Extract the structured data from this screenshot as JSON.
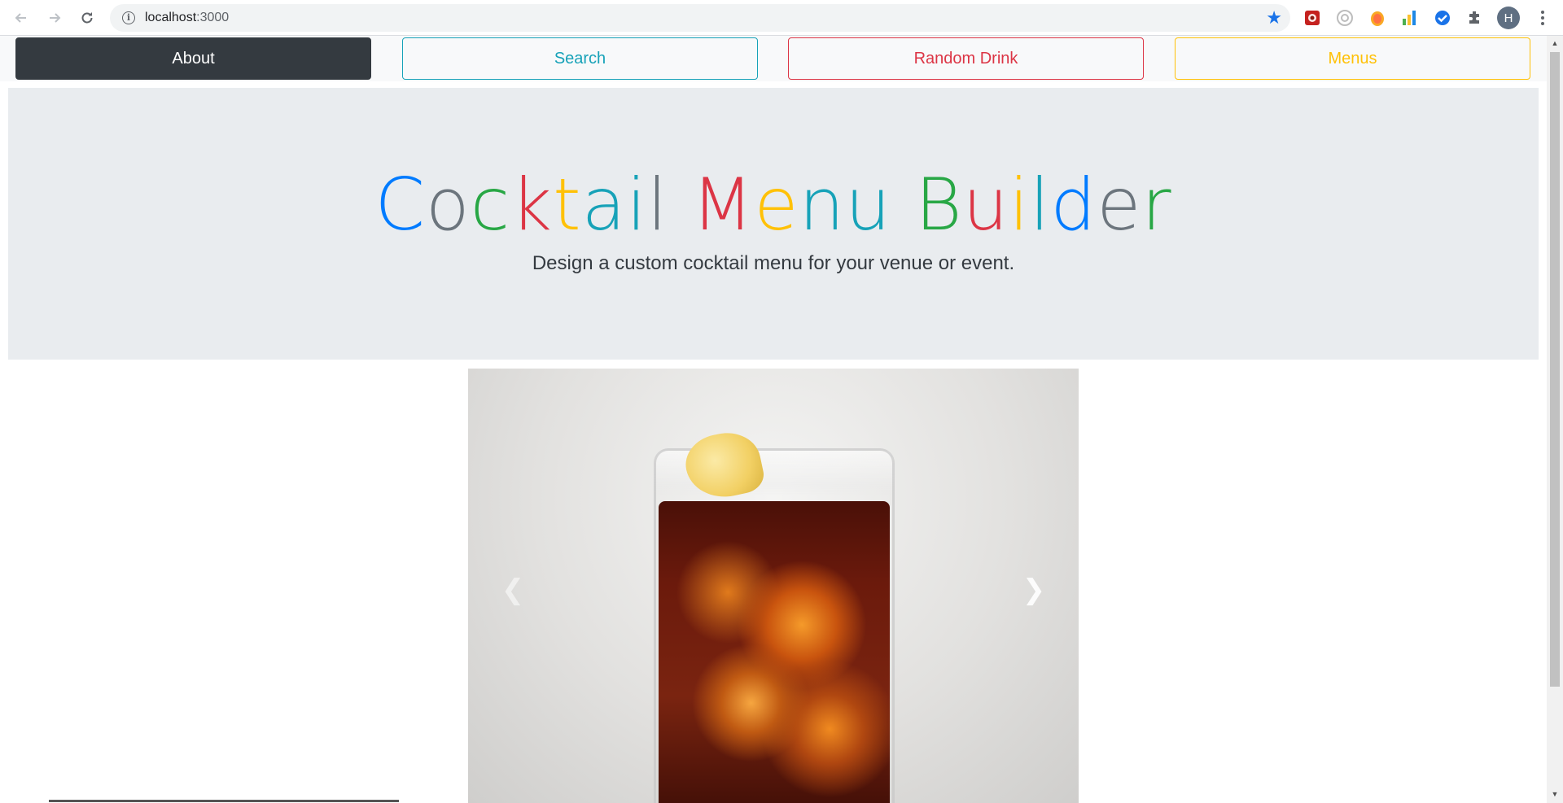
{
  "browser": {
    "url_host": "localhost",
    "url_port": ":3000",
    "avatar_initial": "H",
    "icons": [
      "back-icon",
      "forward-icon",
      "reload-icon",
      "info-icon",
      "star-icon",
      "extensions-icon",
      "menu-icon"
    ]
  },
  "nav": {
    "about": "About",
    "search": "Search",
    "random_drink": "Random Drink",
    "menus": "Menus"
  },
  "hero": {
    "title_letters": [
      {
        "char": "C",
        "color": "#007bff"
      },
      {
        "char": "o",
        "color": "#6c757d"
      },
      {
        "char": "c",
        "color": "#28a745"
      },
      {
        "char": "k",
        "color": "#dc3545"
      },
      {
        "char": "t",
        "color": "#ffc107"
      },
      {
        "char": "a",
        "color": "#17a2b8"
      },
      {
        "char": "i",
        "color": "#17a2b8"
      },
      {
        "char": "l",
        "color": "#6c757d"
      },
      {
        "char": " ",
        "color": "#000000"
      },
      {
        "char": "M",
        "color": "#dc3545"
      },
      {
        "char": "e",
        "color": "#ffc107"
      },
      {
        "char": "n",
        "color": "#17a2b8"
      },
      {
        "char": "u",
        "color": "#17a2b8"
      },
      {
        "char": " ",
        "color": "#000000"
      },
      {
        "char": "B",
        "color": "#28a745"
      },
      {
        "char": "u",
        "color": "#dc3545"
      },
      {
        "char": "i",
        "color": "#ffc107"
      },
      {
        "char": "l",
        "color": "#17a2b8"
      },
      {
        "char": "d",
        "color": "#007bff"
      },
      {
        "char": "e",
        "color": "#6c757d"
      },
      {
        "char": "r",
        "color": "#28a745"
      }
    ],
    "subtitle": "Design a custom cocktail menu for your venue or event."
  },
  "carousel": {
    "prev_icon": "chevron-left-icon",
    "next_icon": "chevron-right-icon",
    "prev_glyph": "❮",
    "next_glyph": "❯"
  }
}
